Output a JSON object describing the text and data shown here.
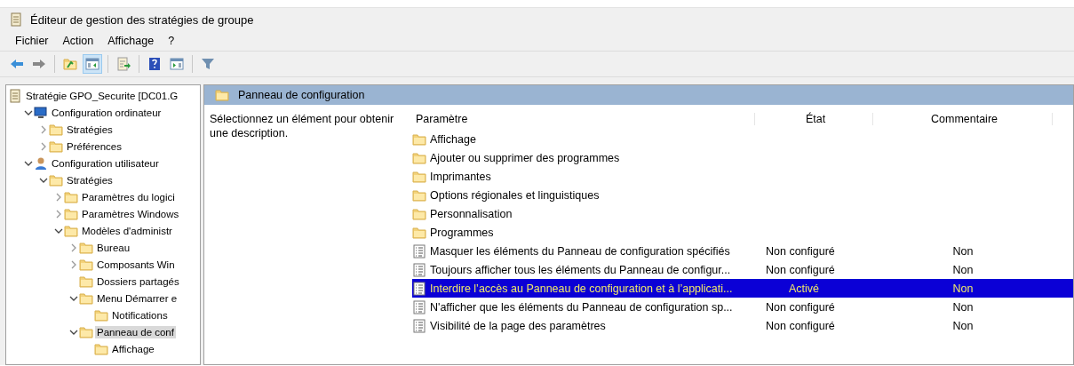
{
  "window": {
    "title": "Éditeur de gestion des stratégies de groupe"
  },
  "menu": [
    "Fichier",
    "Action",
    "Affichage",
    "?"
  ],
  "toolbar": [
    {
      "kind": "back",
      "pressed": false
    },
    {
      "kind": "forward",
      "pressed": false
    },
    {
      "kind": "sep"
    },
    {
      "kind": "up",
      "pressed": false
    },
    {
      "kind": "tree",
      "pressed": true
    },
    {
      "kind": "sep"
    },
    {
      "kind": "export",
      "pressed": false
    },
    {
      "kind": "sep"
    },
    {
      "kind": "help",
      "pressed": false
    },
    {
      "kind": "panel",
      "pressed": false
    },
    {
      "kind": "sep"
    },
    {
      "kind": "filter",
      "pressed": false
    }
  ],
  "tree": [
    {
      "label": "Stratégie GPO_Securite [DC01.G",
      "kind": "policy",
      "selected": false,
      "children": [
        {
          "label": "Configuration ordinateur",
          "kind": "computer",
          "expanded": true,
          "selected": false,
          "children": [
            {
              "label": "Stratégies",
              "kind": "folder",
              "expanded": false,
              "selected": false
            },
            {
              "label": "Préférences",
              "kind": "folder",
              "expanded": false,
              "selected": false
            }
          ]
        },
        {
          "label": "Configuration utilisateur",
          "kind": "user",
          "expanded": true,
          "selected": false,
          "children": [
            {
              "label": "Stratégies",
              "kind": "folder",
              "expanded": true,
              "selected": false,
              "children": [
                {
                  "label": "Paramètres du logici",
                  "kind": "folder",
                  "expanded": false,
                  "selected": false
                },
                {
                  "label": "Paramètres Windows",
                  "kind": "folder",
                  "expanded": false,
                  "selected": false
                },
                {
                  "label": "Modèles d'administr",
                  "kind": "folder",
                  "expanded": true,
                  "selected": false,
                  "children": [
                    {
                      "label": "Bureau",
                      "kind": "folder",
                      "expanded": false,
                      "selected": false
                    },
                    {
                      "label": "Composants Win",
                      "kind": "folder",
                      "expanded": false,
                      "selected": false
                    },
                    {
                      "label": "Dossiers partagés",
                      "kind": "folder",
                      "selected": false
                    },
                    {
                      "label": "Menu Démarrer e",
                      "kind": "folder",
                      "expanded": true,
                      "selected": false,
                      "children": [
                        {
                          "label": "Notifications",
                          "kind": "folder",
                          "selected": false
                        }
                      ]
                    },
                    {
                      "label": "Panneau de conf",
                      "kind": "folder",
                      "expanded": true,
                      "selected": true,
                      "children": [
                        {
                          "label": "Affichage",
                          "kind": "folder",
                          "selected": false
                        }
                      ]
                    }
                  ]
                }
              ]
            }
          ]
        }
      ]
    }
  ],
  "panel": {
    "title": "Panneau de configuration",
    "description": "Sélectionnez un élément pour obtenir une description."
  },
  "table": {
    "columns": [
      "Paramètre",
      "État",
      "Commentaire"
    ],
    "rows": [
      {
        "kind": "folder",
        "name": "Affichage",
        "selected": false
      },
      {
        "kind": "folder",
        "name": "Ajouter ou supprimer des programmes",
        "selected": false
      },
      {
        "kind": "folder",
        "name": "Imprimantes",
        "selected": false
      },
      {
        "kind": "folder",
        "name": "Options régionales et linguistiques",
        "selected": false
      },
      {
        "kind": "folder",
        "name": "Personnalisation",
        "selected": false
      },
      {
        "kind": "folder",
        "name": "Programmes",
        "selected": false
      },
      {
        "kind": "setting",
        "name": "Masquer les éléments du Panneau de configuration spécifiés",
        "state": "Non configuré",
        "comment": "Non",
        "selected": false
      },
      {
        "kind": "setting",
        "name": "Toujours afficher tous les éléments du Panneau de configur...",
        "state": "Non configuré",
        "comment": "Non",
        "selected": false
      },
      {
        "kind": "setting",
        "name": "Interdire l’accès au Panneau de configuration et à l’applicati...",
        "state": "Activé",
        "comment": "Non",
        "selected": true
      },
      {
        "kind": "setting",
        "name": "N'afficher que les éléments du Panneau de configuration sp...",
        "state": "Non configuré",
        "comment": "Non",
        "selected": false
      },
      {
        "kind": "setting",
        "name": "Visibilité de la page des paramètres",
        "state": "Non configuré",
        "comment": "Non",
        "selected": false
      }
    ]
  }
}
